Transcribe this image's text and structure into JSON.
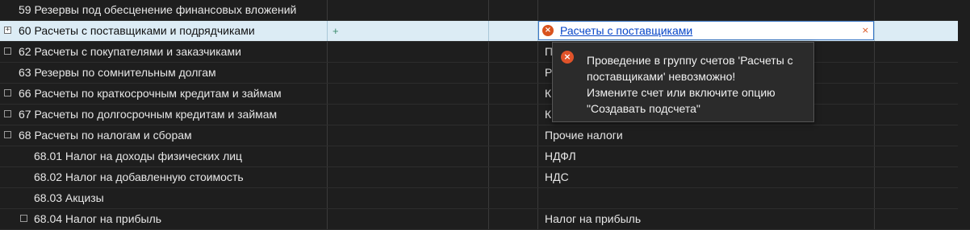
{
  "rows": [
    {
      "name": "59 Резервы под обесценение финансовых вложений",
      "value": "",
      "toggle": ""
    },
    {
      "name": "60 Расчеты с поставщиками и подрядчиками",
      "value": "Расчеты с поставщиками",
      "toggle": "+"
    },
    {
      "name": "62 Расчеты с покупателями и заказчиками",
      "value": "П",
      "toggle": ""
    },
    {
      "name": "63 Резервы по сомнительным долгам",
      "value": "Р",
      "toggle": ""
    },
    {
      "name": "66 Расчеты по краткосрочным кредитам и займам",
      "value": "К",
      "toggle": ""
    },
    {
      "name": "67 Расчеты по долгосрочным кредитам и займам",
      "value": "К",
      "toggle": ""
    },
    {
      "name": "68 Расчеты по налогам и сборам",
      "value": "Прочие налоги",
      "toggle": ""
    },
    {
      "name": "68.01 Налог на доходы физических лиц",
      "value": "НДФЛ",
      "toggle": ""
    },
    {
      "name": "68.02 Налог на добавленную стоимость",
      "value": "НДС",
      "toggle": ""
    },
    {
      "name": "68.03 Акцизы",
      "value": "",
      "toggle": ""
    },
    {
      "name": "68.04 Налог на прибыль",
      "value": "Налог на прибыль",
      "toggle": ""
    }
  ],
  "add_glyph": "+",
  "clear_glyph": "×",
  "error_glyph": "×",
  "tooltip": {
    "lines": [
      "Проведение в группу счетов 'Расчеты с",
      "поставщиками' невозможно!",
      "Измените счет или включите опцию",
      "\"Создавать подсчета\""
    ]
  },
  "colors": {
    "background": "#1e1e1e",
    "selected_row": "#dcecf5",
    "error": "#d9531e",
    "link": "#0645c8"
  },
  "icons": [
    "plus-icon",
    "error-icon",
    "clear-icon",
    "expand-toggle-icon"
  ]
}
